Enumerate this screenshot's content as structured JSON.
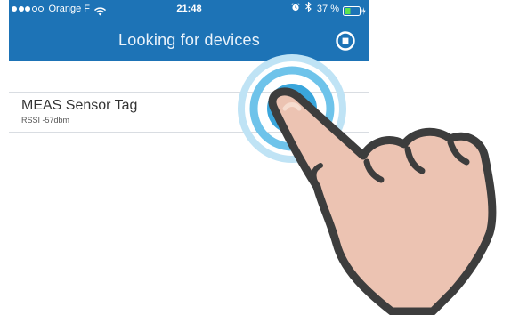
{
  "status_bar": {
    "signal_dots_filled": 3,
    "signal_dots_total": 5,
    "carrier": "Orange F",
    "time": "21:48",
    "battery_percent": "37 %",
    "icons": [
      "wifi-icon",
      "alarm-icon",
      "bluetooth-icon",
      "battery-icon"
    ]
  },
  "nav": {
    "title": "Looking for devices",
    "action_icon": "refresh-icon"
  },
  "devices": [
    {
      "name": "MEAS Sensor Tag",
      "rssi": "RSSI -57dbm"
    }
  ],
  "overlay": {
    "gesture": "tap",
    "icons": [
      "tap-ripple-icon",
      "pointing-hand-icon"
    ]
  },
  "colors": {
    "header_bg": "#1d73b6",
    "ripple_blue": "#4fb6e6",
    "hand_fill": "#ecc3b2",
    "hand_outline": "#3d3d3d"
  }
}
